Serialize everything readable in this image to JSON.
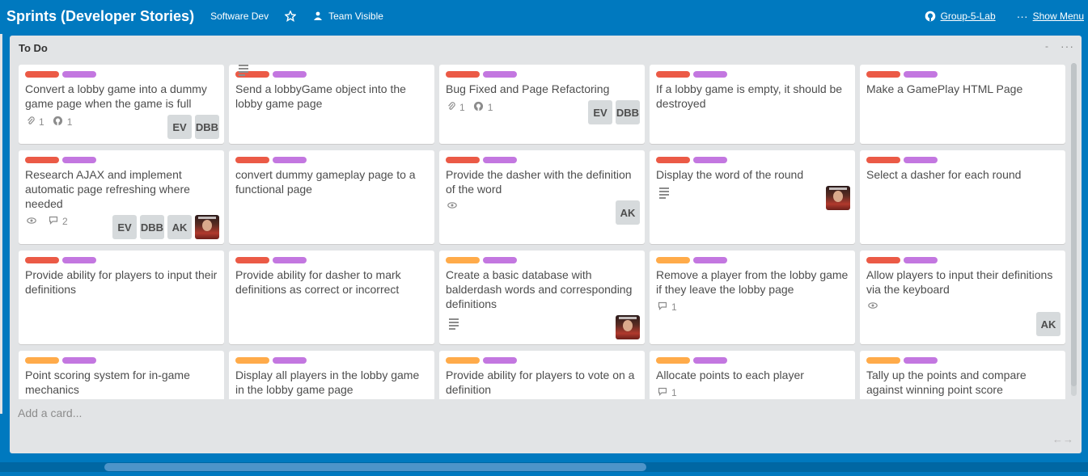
{
  "header": {
    "board_title": "Sprints (Developer Stories)",
    "team": "Software Dev",
    "visibility": "Team Visible",
    "org": "Group-5-Lab",
    "menu": "Show Menu",
    "icons": {
      "star": "star-icon",
      "visibility": "team-visibility-icon",
      "org": "github-icon",
      "menu": "more-icon"
    }
  },
  "list": {
    "title": "To Do",
    "collapse": "-",
    "menu": "···",
    "add_card": "Add a card...",
    "resize": "←→"
  },
  "colors": {
    "board_bg": "#0079bf",
    "list_bg": "#e2e4e6",
    "label_red": "#eb5a46",
    "label_purple": "#c377e0",
    "label_orange": "#ffab4a"
  },
  "cards": [
    {
      "title": "Convert a lobby game into a dummy game page when the game is full",
      "labels": [
        "red",
        "purple"
      ],
      "attachments": "1",
      "github": "1",
      "members": [
        "EV",
        "DBB"
      ]
    },
    {
      "title": "Send a lobbyGame object into the lobby game page",
      "labels": [
        "red",
        "purple"
      ],
      "description": true
    },
    {
      "title": "Bug Fixed and Page Refactoring",
      "labels": [
        "red",
        "purple"
      ],
      "attachments": "1",
      "github": "1",
      "members": [
        "EV",
        "DBB"
      ]
    },
    {
      "title": "If a lobby game is empty, it should be destroyed",
      "labels": [
        "red",
        "purple"
      ]
    },
    {
      "title": "Make a GamePlay HTML Page",
      "labels": [
        "red",
        "purple"
      ]
    },
    {
      "title": "Research AJAX and implement automatic page refreshing where needed",
      "labels": [
        "red",
        "purple"
      ],
      "watch": true,
      "comments": "2",
      "members": [
        "EV",
        "DBB",
        "AK"
      ],
      "photo": true
    },
    {
      "title": "convert dummy gameplay page to a functional page",
      "labels": [
        "red",
        "purple"
      ]
    },
    {
      "title": "Provide the dasher with the definition of the word",
      "labels": [
        "red",
        "purple"
      ],
      "watch": true,
      "members": [
        "AK"
      ]
    },
    {
      "title": "Display the word of the round",
      "labels": [
        "red",
        "purple"
      ],
      "description": true,
      "photo": true
    },
    {
      "title": "Select a dasher for each round",
      "labels": [
        "red",
        "purple"
      ]
    },
    {
      "title": "Provide ability for players to input their definitions",
      "labels": [
        "red",
        "purple"
      ]
    },
    {
      "title": "Provide ability for dasher to mark definitions as correct or incorrect",
      "labels": [
        "red",
        "purple"
      ]
    },
    {
      "title": "Create a basic database with balderdash words and corresponding definitions",
      "labels": [
        "orange",
        "purple"
      ],
      "description": true,
      "photo": true
    },
    {
      "title": "Remove a player from the lobby game if they leave the lobby page",
      "labels": [
        "orange",
        "purple"
      ],
      "comments": "1"
    },
    {
      "title": "Allow players to input their definitions via the keyboard",
      "labels": [
        "red",
        "purple"
      ],
      "watch": true,
      "members": [
        "AK"
      ]
    },
    {
      "title": "Point scoring system for in-game mechanics",
      "labels": [
        "orange",
        "purple"
      ]
    },
    {
      "title": "Display all players in the lobby game in the lobby game page",
      "labels": [
        "orange",
        "purple"
      ]
    },
    {
      "title": "Provide ability for players to vote on a definition",
      "labels": [
        "orange",
        "purple"
      ]
    },
    {
      "title": "Allocate points to each player",
      "labels": [
        "orange",
        "purple"
      ],
      "comments": "1"
    },
    {
      "title": "Tally up the points and compare against winning point score",
      "labels": [
        "orange",
        "purple"
      ]
    }
  ]
}
